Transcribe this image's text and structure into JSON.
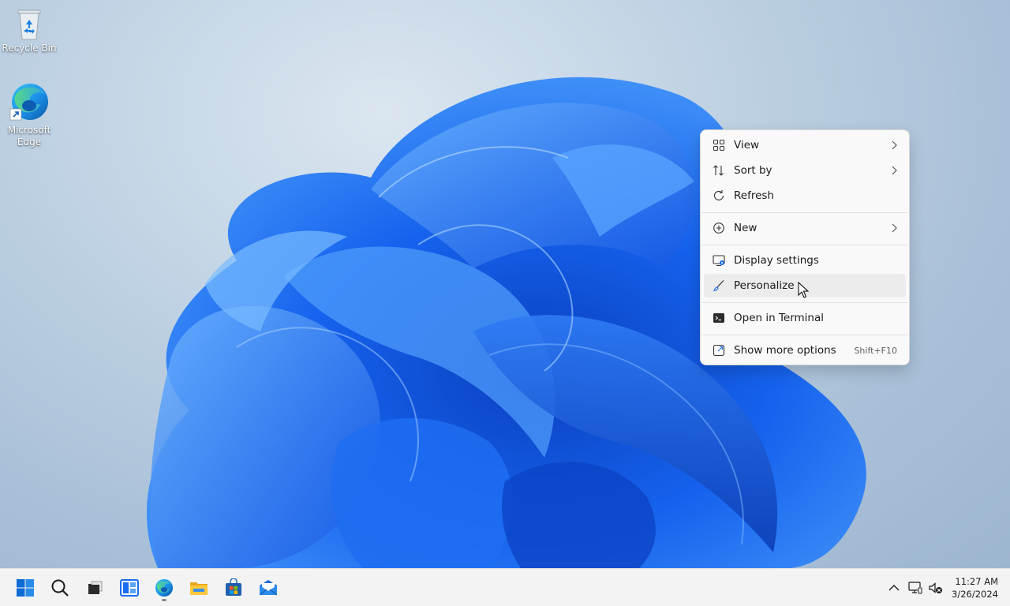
{
  "desktop": {
    "icons": [
      {
        "label": "Recycle Bin",
        "icon": "recycle-bin-icon"
      },
      {
        "label_line1": "Microsoft",
        "label_line2": "Edge",
        "icon": "edge-icon"
      }
    ],
    "accent_color": "#1a6cf0"
  },
  "context_menu": {
    "items": [
      {
        "label": "View",
        "icon": "view-grid-icon",
        "has_submenu": true
      },
      {
        "label": "Sort by",
        "icon": "sort-icon",
        "has_submenu": true
      },
      {
        "label": "Refresh",
        "icon": "refresh-icon"
      },
      {
        "label": "New",
        "icon": "new-plus-icon",
        "has_submenu": true
      },
      {
        "label": "Display settings",
        "icon": "display-settings-icon"
      },
      {
        "label": "Personalize",
        "icon": "brush-icon",
        "hovered": true
      },
      {
        "label": "Open in Terminal",
        "icon": "terminal-icon"
      },
      {
        "label": "Show more options",
        "icon": "show-more-icon",
        "shortcut": "Shift+F10"
      }
    ]
  },
  "taskbar": {
    "buttons": [
      {
        "name": "start",
        "icon": "windows-start-icon"
      },
      {
        "name": "search",
        "icon": "search-icon"
      },
      {
        "name": "task-view",
        "icon": "task-view-icon"
      },
      {
        "name": "widgets",
        "icon": "widgets-icon"
      },
      {
        "name": "edge",
        "icon": "edge-icon",
        "active": true
      },
      {
        "name": "file-explorer",
        "icon": "folder-icon"
      },
      {
        "name": "store",
        "icon": "store-icon"
      },
      {
        "name": "mail",
        "icon": "mail-icon"
      }
    ],
    "tray": {
      "icons": [
        "chevron-up-icon",
        "network-icon",
        "volume-muted-icon"
      ],
      "time": "11:27 AM",
      "date": "3/26/2024"
    }
  }
}
